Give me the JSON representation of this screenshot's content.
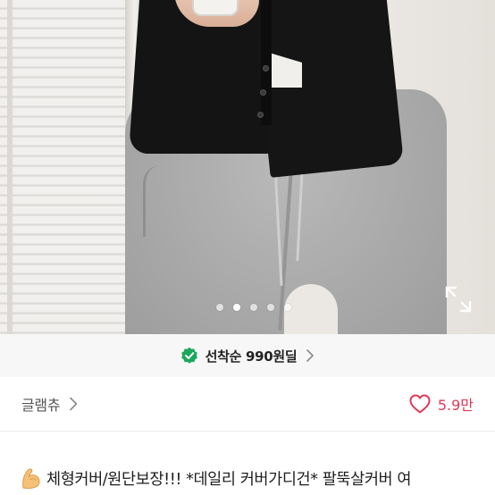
{
  "product_image": {
    "slide_count": 5,
    "active_slide_index": 1,
    "expand_icon": "expand-arrows-icon"
  },
  "deal_banner": {
    "badge_icon": "green-check-badge-icon",
    "label": "선착순 990원딜",
    "chevron_icon": "chevron-right-icon",
    "accent_color": "#1aa85c"
  },
  "shop": {
    "name": "글램츄",
    "chevron_icon": "chevron-right-icon",
    "likes_icon": "heart-outline-icon",
    "likes_count": "5.9만",
    "likes_color": "#e03a57"
  },
  "product": {
    "title_icon": "flexed-biceps-emoji-icon",
    "title": "체형커버/원단보장!!! *데일리 커버가디건* 팔뚝살커버 여"
  }
}
